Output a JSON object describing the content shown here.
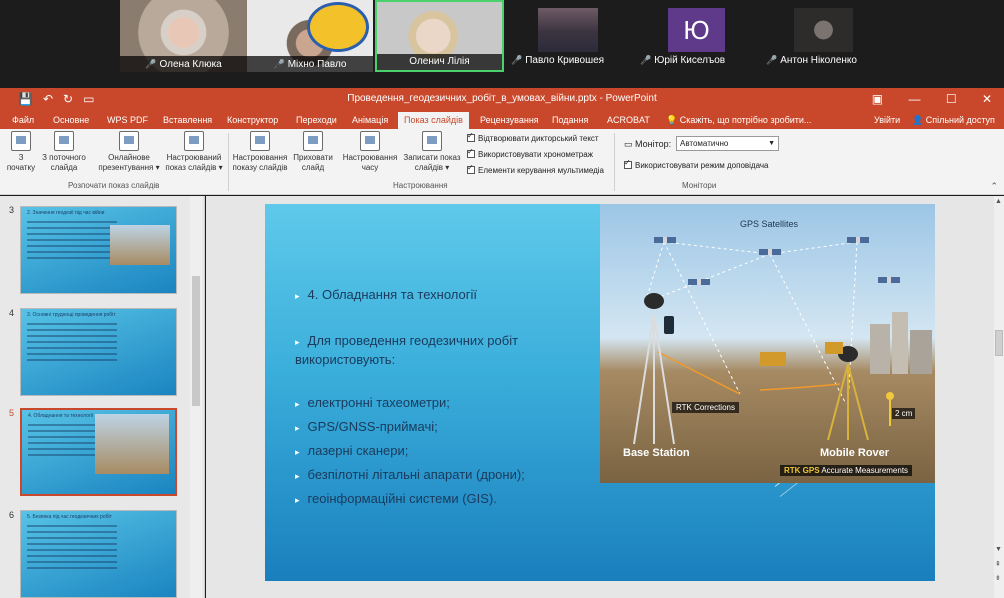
{
  "participants": [
    {
      "name": "Олена Клюка",
      "muted": true
    },
    {
      "name": "Міхно Павло",
      "muted": true
    },
    {
      "name": "Оленич Лілія",
      "muted": false
    },
    {
      "name": "Павло Кривошея",
      "muted": true
    },
    {
      "name": "Юрій Киселъов",
      "muted": true,
      "initial": "Ю"
    },
    {
      "name": "Антон Ніколенко",
      "muted": true
    }
  ],
  "window": {
    "title": "Проведення_геодезичних_робіт_в_умовах_війни.pptx - PowerPoint"
  },
  "tabs": [
    "Файл",
    "Основне",
    "WPS PDF",
    "Вставлення",
    "Конструктор",
    "Переходи",
    "Анімація",
    "Показ слайдів",
    "Рецензування",
    "Подання",
    "ACROBAT"
  ],
  "active_tab": "Показ слайдів",
  "tell_me": "Скажіть, що потрібно зробити...",
  "sign_in": "Увійти",
  "share": "Спільний доступ",
  "ribbon": {
    "start_group": {
      "label": "Розпочати показ слайдів",
      "buttons": [
        {
          "line1": "З",
          "line2": "початку"
        },
        {
          "line1": "З поточного",
          "line2": "слайда"
        },
        {
          "line1": "Онлайнове",
          "line2": "презентування ▾"
        },
        {
          "line1": "Настроюваний",
          "line2": "показ слайдів ▾"
        }
      ]
    },
    "setup_group": {
      "label": "Настроювання",
      "buttons": [
        {
          "line1": "Настроювання",
          "line2": "показу слайдів"
        },
        {
          "line1": "Приховати",
          "line2": "слайд"
        },
        {
          "line1": "Настроювання",
          "line2": "часу"
        },
        {
          "line1": "Записати показ",
          "line2": "слайдів ▾"
        }
      ],
      "checkboxes": [
        "Відтворювати дикторський текст",
        "Використовувати хронометраж",
        "Елементи керування мультимедіа"
      ]
    },
    "monitors_group": {
      "label": "Монітори",
      "monitor_label": "Монітор:",
      "monitor_value": "Автоматично",
      "presenter_view": "Використовувати режим доповідача"
    }
  },
  "thumbnails": [
    {
      "num": "3",
      "title": "2. Значення геодезії під час війни",
      "selected": false
    },
    {
      "num": "4",
      "title": "3. Основні труднощі проведення робіт",
      "selected": false
    },
    {
      "num": "5",
      "title": "4. Обладнання та технології",
      "selected": true
    },
    {
      "num": "6",
      "title": "5. Безпека під час геодезичних робіт",
      "selected": false
    }
  ],
  "slide": {
    "heading": "4. Обладнання та технології",
    "intro": "Для проведення геодезичних робіт використовують:",
    "items": [
      "електронні тахеометри;",
      "GPS/GNSS-приймачі;",
      "лазерні сканери;",
      "безпілотні літальні апарати (дрони);",
      "геоінформаційні системи (GIS)."
    ],
    "infographic": {
      "satellites_label": "GPS Satellites",
      "rtk_corrections": "RTK Corrections",
      "base_station": "Base Station",
      "mobile_rover": "Mobile Rover",
      "distance": "2 cm",
      "rtk_gps_bold": "RTK GPS",
      "rtk_gps_rest": "Accurate Measurements"
    }
  }
}
